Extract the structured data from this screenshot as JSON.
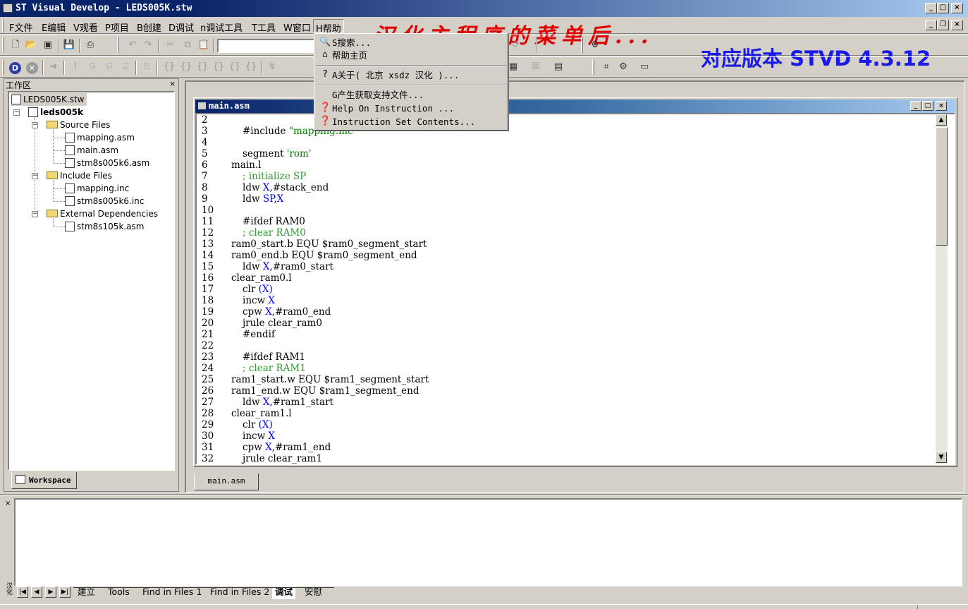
{
  "window": {
    "title": "ST Visual Develop - LEDS005K.stw",
    "buttons": [
      "_",
      "□",
      "×"
    ]
  },
  "menubar": {
    "items": [
      {
        "label": "F文件"
      },
      {
        "label": "E编辑"
      },
      {
        "label": "V观看"
      },
      {
        "label": "P项目"
      },
      {
        "label": "B创建"
      },
      {
        "label": "D调试"
      },
      {
        "label": "n调试工具"
      },
      {
        "label": "T工具"
      },
      {
        "label": "W窗口"
      },
      {
        "label": "H帮助"
      }
    ]
  },
  "annotations": {
    "red": "汉化主程序的菜单后...",
    "blue": "对应版本 STVD 4.3.12",
    "red_color": "#e00000",
    "blue_color": "#1a1ae6"
  },
  "help_menu": {
    "items": [
      {
        "label": "S搜索...",
        "icon": "search-icon"
      },
      {
        "label": "帮助主页",
        "icon": "home-icon"
      },
      {
        "label": "A关于( 北京 xsdz 汉化 )...",
        "icon": "question-icon"
      },
      {
        "label": "G产生获取支持文件...",
        "icon": ""
      },
      {
        "label": "Help On Instruction ...",
        "icon": "help-book-icon"
      },
      {
        "label": "Instruction Set Contents...",
        "icon": "help-book-icon"
      }
    ]
  },
  "workspace": {
    "title": "工作区",
    "tab_label": "Workspace",
    "tree": {
      "root": "LEDS005K.stw",
      "project": "leds005k",
      "folders": [
        {
          "name": "Source Files",
          "files": [
            "mapping.asm",
            "main.asm",
            "stm8s005k6.asm"
          ]
        },
        {
          "name": "Include Files",
          "files": [
            "mapping.inc",
            "stm8s005k6.inc"
          ]
        },
        {
          "name": "External Dependencies",
          "files": [
            "stm8s105k.asm"
          ]
        }
      ]
    }
  },
  "editor": {
    "title": "main.asm",
    "tab_label": "main.asm",
    "lines": [
      {
        "n": "2",
        "text": "",
        "indent": 0
      },
      {
        "n": "3",
        "text": "#include \"mapping.inc\"",
        "indent": 1
      },
      {
        "n": "4",
        "text": "",
        "indent": 0
      },
      {
        "n": "5",
        "text": "segment 'rom'",
        "indent": 1
      },
      {
        "n": "6",
        "text": "main.l",
        "indent": 0
      },
      {
        "n": "7",
        "text": "; initialize SP",
        "indent": 1
      },
      {
        "n": "8",
        "text": "ldw X,#stack_end",
        "indent": 1
      },
      {
        "n": "9",
        "text": "ldw SP,X",
        "indent": 1
      },
      {
        "n": "10",
        "text": "",
        "indent": 0
      },
      {
        "n": "11",
        "text": "#ifdef RAM0",
        "indent": 1
      },
      {
        "n": "12",
        "text": "; clear RAM0",
        "indent": 1
      },
      {
        "n": "13",
        "text": "ram0_start.b EQU $ram0_segment_start",
        "indent": 0
      },
      {
        "n": "14",
        "text": "ram0_end.b EQU $ram0_segment_end",
        "indent": 0
      },
      {
        "n": "15",
        "text": "ldw X,#ram0_start",
        "indent": 1
      },
      {
        "n": "16",
        "text": "clear_ram0.l",
        "indent": 0
      },
      {
        "n": "17",
        "text": "clr (X)",
        "indent": 1
      },
      {
        "n": "18",
        "text": "incw X",
        "indent": 1
      },
      {
        "n": "19",
        "text": "cpw X,#ram0_end",
        "indent": 1
      },
      {
        "n": "20",
        "text": "jrule clear_ram0",
        "indent": 1
      },
      {
        "n": "21",
        "text": "#endif",
        "indent": 1
      },
      {
        "n": "22",
        "text": "",
        "indent": 0
      },
      {
        "n": "23",
        "text": "#ifdef RAM1",
        "indent": 1
      },
      {
        "n": "24",
        "text": "; clear RAM1",
        "indent": 1
      },
      {
        "n": "25",
        "text": "ram1_start.w EQU $ram1_segment_start",
        "indent": 0
      },
      {
        "n": "26",
        "text": "ram1_end.w EQU $ram1_segment_end",
        "indent": 0
      },
      {
        "n": "27",
        "text": "ldw X,#ram1_start",
        "indent": 1
      },
      {
        "n": "28",
        "text": "clear_ram1.l",
        "indent": 0
      },
      {
        "n": "29",
        "text": "clr (X)",
        "indent": 1
      },
      {
        "n": "30",
        "text": "incw X",
        "indent": 1
      },
      {
        "n": "31",
        "text": "cpw X,#ram1_end",
        "indent": 1
      },
      {
        "n": "32",
        "text": "jrule clear_ram1",
        "indent": 1
      }
    ]
  },
  "output": {
    "side_label": "汉化",
    "tabs": [
      "建立",
      "Tools",
      "Find in Files 1",
      "Find in Files 2",
      "调试",
      "安慰"
    ],
    "active_tab": "调试"
  }
}
